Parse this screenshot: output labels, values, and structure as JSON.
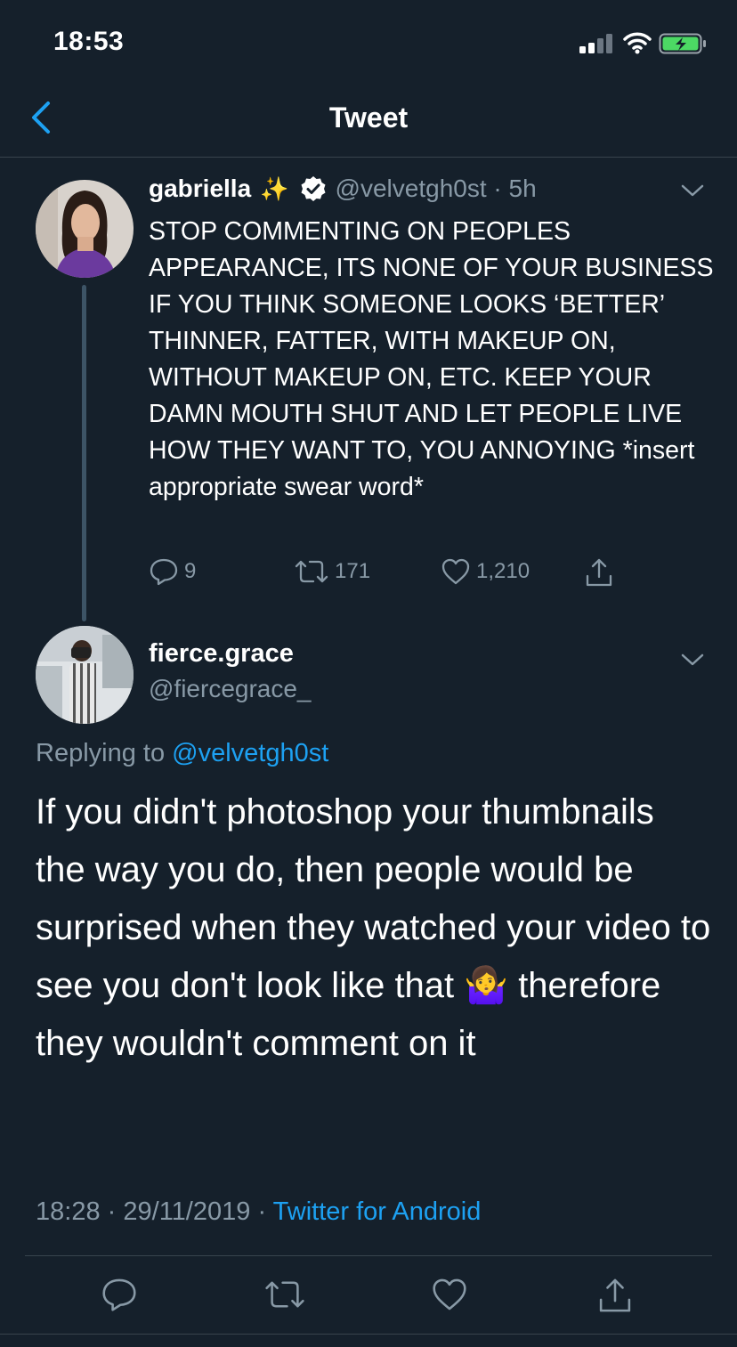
{
  "status_bar": {
    "time": "18:53"
  },
  "nav": {
    "title": "Tweet"
  },
  "parent_tweet": {
    "display_name": "gabriella",
    "name_emoji": "✨",
    "handle": "@velvetgh0st",
    "separator": "·",
    "age": "5h",
    "text": "STOP COMMENTING ON PEOPLES APPEARANCE, ITS NONE OF YOUR BUSINESS IF YOU THINK SOMEONE LOOKS ‘BETTER’ THINNER, FATTER, WITH MAKEUP ON, WITHOUT MAKEUP ON, ETC. KEEP YOUR DAMN MOUTH SHUT AND LET PEOPLE LIVE HOW THEY WANT TO, YOU ANNOYING *insert appropriate swear word*",
    "replies": "9",
    "retweets": "171",
    "likes": "1,210"
  },
  "main_tweet": {
    "display_name": "fierce.grace",
    "handle": "@fiercegrace_",
    "replying_prefix": "Replying to",
    "replying_to": "@velvetgh0st",
    "text": "If you didn't photoshop your thumbnails the way you do, then people would be surprised when they watched your video to see you don't look like that 🤷‍♀️ therefore they wouldn't comment on it",
    "time": "18:28",
    "date": "29/11/2019",
    "separator": "·",
    "source": "Twitter for Android"
  },
  "colors": {
    "background": "#15202b",
    "accent": "#1da1f2",
    "muted": "#8899a6",
    "divider": "#38444d"
  }
}
